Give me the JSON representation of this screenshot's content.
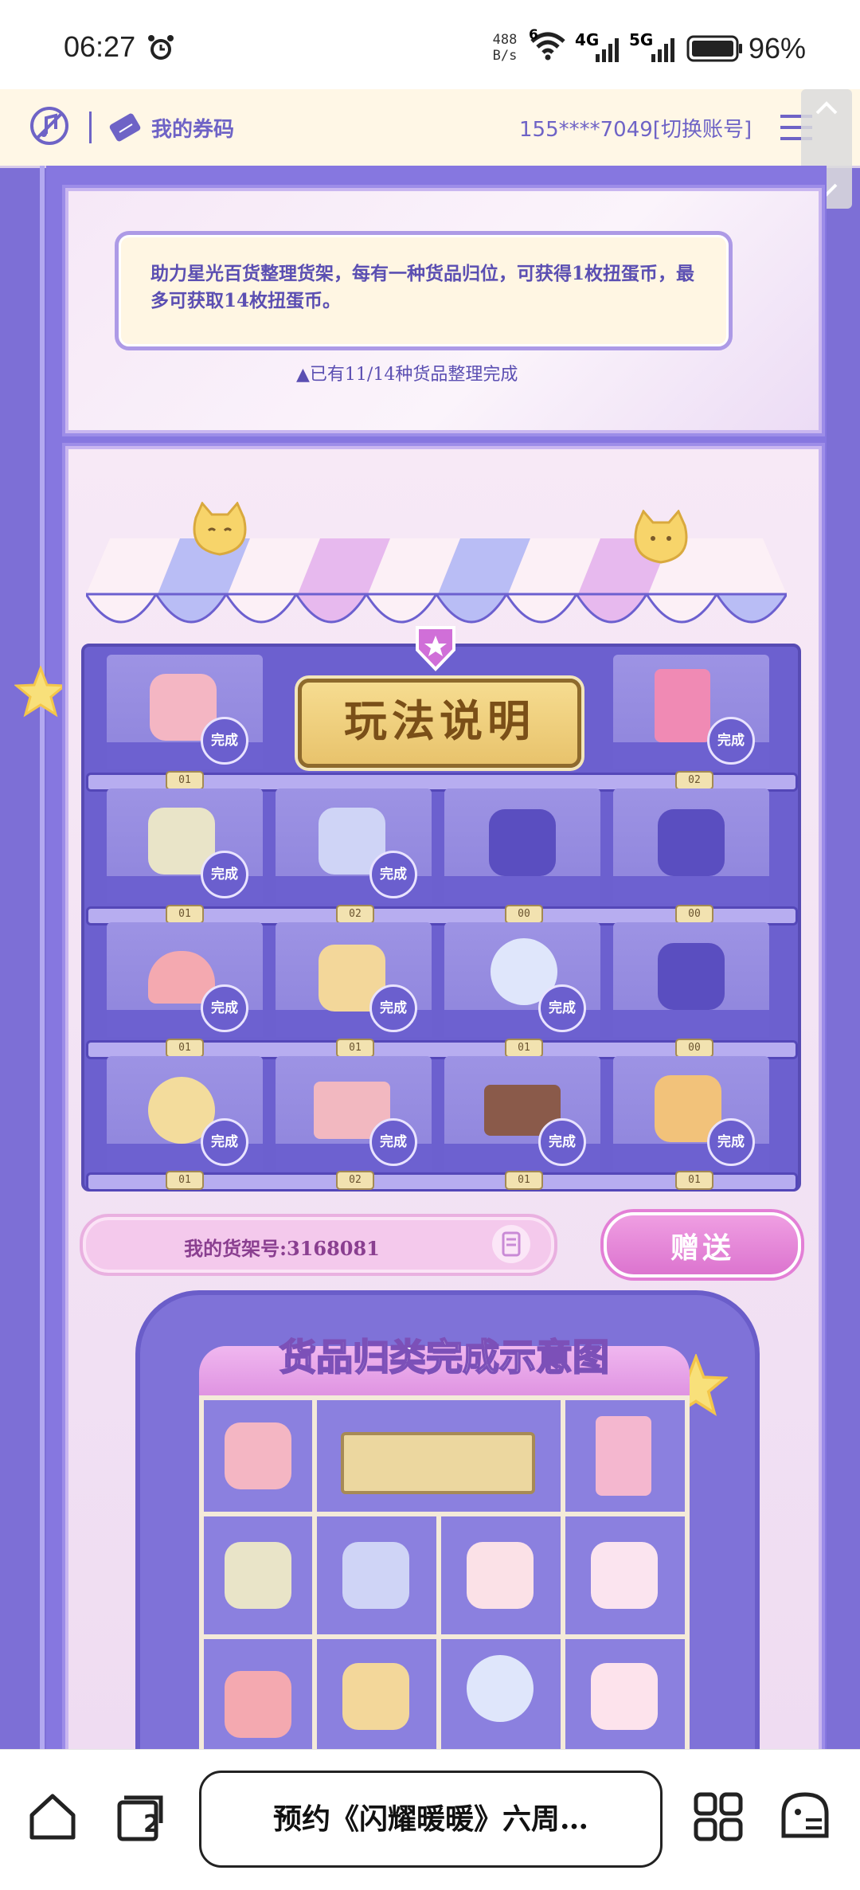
{
  "status_bar": {
    "time": "06:27",
    "net_rate_value": "488",
    "net_rate_unit": "B/s",
    "net_a": "6",
    "net_b": "4G",
    "net_c": "5G",
    "battery": "96%"
  },
  "top_bar": {
    "coupon_label": "我的券码",
    "account": "155****7049[切换账号]"
  },
  "info": {
    "text": "助力星光百货整理货架，每有一种货品归位，可获得1枚扭蛋币，最多可获取14枚扭蛋币。",
    "progress": "▲已有11/14种货品整理完成"
  },
  "howto_label": "玩法说明",
  "done_label": "完成",
  "shelf": {
    "tags": [
      [
        "01",
        "",
        "",
        "02"
      ],
      [
        "01",
        "02",
        "00",
        "00"
      ],
      [
        "01",
        "01",
        "01",
        "00"
      ],
      [
        "01",
        "02",
        "01",
        "01"
      ]
    ]
  },
  "shelf_number": "我的货架号:3168081",
  "gift_label": "赠送",
  "diagram_title": "货品归类完成示意图",
  "bottom_nav": {
    "tab_count": "2",
    "address_text": "预约《闪耀暖暖》六周…"
  },
  "colors": {
    "accent": "#6e63c6",
    "shelf": "#6c60cf",
    "gold": "#e8c36c",
    "pink": "#dc74cf"
  }
}
